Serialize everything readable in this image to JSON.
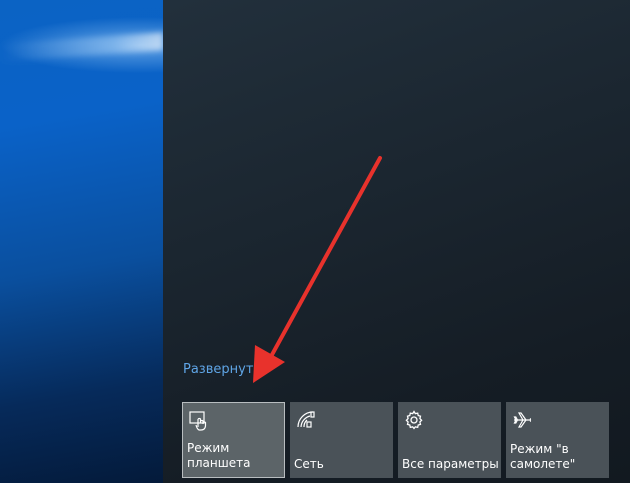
{
  "action_center": {
    "expand_label": "Развернуть",
    "tiles": [
      {
        "label": "Режим\nпланшета",
        "icon": "tablet-mode-icon",
        "active": true
      },
      {
        "label": "Сеть",
        "icon": "network-icon",
        "active": false
      },
      {
        "label": "Все параметры",
        "icon": "gear-icon",
        "active": false
      },
      {
        "label": "Режим \"в\nсамолете\"",
        "icon": "airplane-icon",
        "active": false
      }
    ]
  },
  "annotation": {
    "color": "#e8322c",
    "icon": "red-arrow-annotation"
  }
}
